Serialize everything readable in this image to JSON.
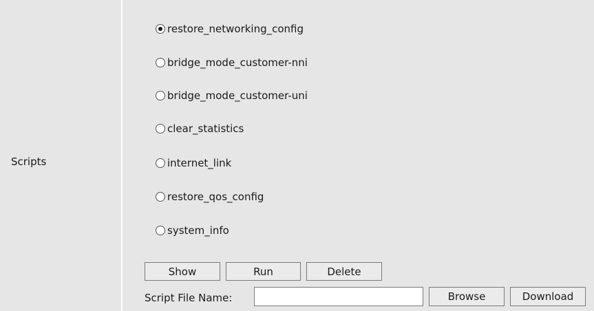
{
  "section": {
    "label": "Scripts"
  },
  "scripts": {
    "options": [
      {
        "label": "restore_networking_config",
        "checked": true
      },
      {
        "label": "bridge_mode_customer-nni",
        "checked": false
      },
      {
        "label": "bridge_mode_customer-uni",
        "checked": false
      },
      {
        "label": "clear_statistics",
        "checked": false
      },
      {
        "label": "internet_link",
        "checked": false
      },
      {
        "label": "restore_qos_config",
        "checked": false
      },
      {
        "label": "system_info",
        "checked": false
      }
    ]
  },
  "actions": {
    "show_label": "Show",
    "run_label": "Run",
    "delete_label": "Delete"
  },
  "file": {
    "label": "Script File Name:",
    "value": "",
    "browse_label": "Browse",
    "download_label": "Download"
  }
}
